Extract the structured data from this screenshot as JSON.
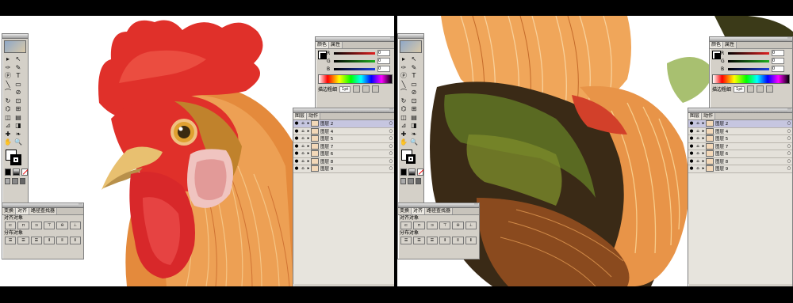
{
  "left": {
    "tools": [
      "▸",
      "↖",
      "✑",
      "✎",
      "ⓟ",
      "T",
      "╲",
      "▭",
      "⌒",
      "⊘",
      "↻",
      "⊡",
      "⌬",
      "⊞",
      "◫",
      "▤",
      "⊿",
      "◨",
      "✚",
      "❧",
      "✋",
      "🔍"
    ],
    "color_tabs": [
      "颜色",
      "属性"
    ],
    "color_channels": [
      {
        "ch": "R",
        "val": "0",
        "color": "#e02020"
      },
      {
        "ch": "G",
        "val": "0",
        "color": "#20b020"
      },
      {
        "ch": "B",
        "val": "0",
        "color": "#2040e0"
      }
    ],
    "stroke_label": "描边粗细",
    "stroke_weight": "1pt",
    "layers_tabs": [
      "图层",
      "动作"
    ],
    "layers": [
      {
        "name": "图层 2",
        "selected": true
      },
      {
        "name": "图层 4",
        "selected": false
      },
      {
        "name": "图层 5",
        "selected": false
      },
      {
        "name": "图层 7",
        "selected": false
      },
      {
        "name": "图层 6",
        "selected": false
      },
      {
        "name": "图层 8",
        "selected": false
      },
      {
        "name": "图层 9",
        "selected": false
      }
    ],
    "align_tabs": [
      "变换",
      "对齐",
      "路径查找器"
    ],
    "align_label": "对齐对象",
    "distribute_label": "分布对象"
  },
  "right": {
    "color_tabs": [
      "颜色",
      "属性"
    ],
    "color_channels": [
      {
        "ch": "R",
        "val": "0",
        "color": "#e02020"
      },
      {
        "ch": "G",
        "val": "0",
        "color": "#20b020"
      },
      {
        "ch": "B",
        "val": "0",
        "color": "#2040e0"
      }
    ],
    "stroke_label": "描边粗细",
    "stroke_weight": "1pt",
    "layers_tabs": [
      "图层",
      "动作"
    ],
    "layers": [
      {
        "name": "图层 2",
        "selected": true
      },
      {
        "name": "图层 4",
        "selected": false
      },
      {
        "name": "图层 5",
        "selected": false
      },
      {
        "name": "图层 7",
        "selected": false
      },
      {
        "name": "图层 6",
        "selected": false
      },
      {
        "name": "图层 8",
        "selected": false
      },
      {
        "name": "图层 9",
        "selected": false
      }
    ],
    "align_tabs": [
      "变换",
      "对齐",
      "路径查找器"
    ],
    "align_label": "对齐对象",
    "distribute_label": "分布对象"
  },
  "colors": {
    "comb": "#e0302a",
    "wattle": "#d8282a",
    "feather_orange": "#e48a3c",
    "feather_light": "#f4c27a",
    "dark_green": "#3a3a1a",
    "bg": "#ffffff"
  }
}
